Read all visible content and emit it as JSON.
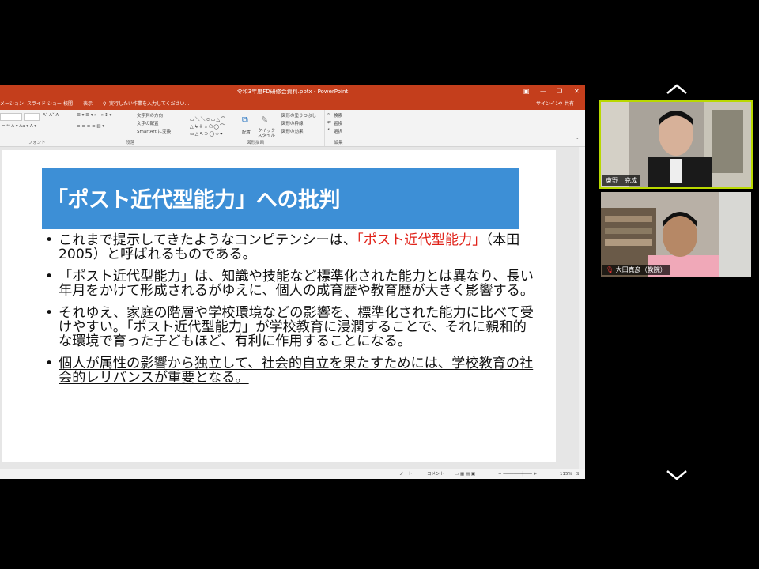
{
  "window": {
    "title": "令和3年度FD研修会資料.pptx - PowerPoint",
    "signin": "サインイン",
    "share": "共有"
  },
  "menu": {
    "tabs": [
      "メーション",
      "スライド ショー",
      "校閲",
      "表示"
    ],
    "tell_me": "実行したい作業を入力してください..."
  },
  "ribbon": {
    "group_font": "フォント",
    "group_paragraph": "段落",
    "group_drawing": "図形描画",
    "group_editing": "編集",
    "text_direction": "文字列の方向",
    "align_text": "文字の配置",
    "smartart": "SmartArt に変換",
    "arrange": "配置",
    "quick_styles": "クイック スタイル",
    "shape_fill": "図形の塗りつぶし",
    "shape_outline": "図形の枠線",
    "shape_effects": "図形の効果",
    "find": "検索",
    "replace": "置換",
    "select": "選択"
  },
  "slide": {
    "title": "「ポスト近代型能力」への批判",
    "b1_a": "これまで提示してきたようなコンピテンシーは、",
    "b1_red": "「ポスト近代型能力」",
    "b1_b": "（本田2005）と呼ばれるものである。",
    "b2": "「ポスト近代型能力」は、知識や技能など標準化された能力とは異なり、長い年月をかけて形成されるがゆえに、個人の成育歴や教育歴が大きく影響する。",
    "b3": "それゆえ、家庭の階層や学校環境などの影響を、標準化された能力に比べて受けやすい。「ポスト近代型能力」が学校教育に浸潤することで、それに親和的な環境で育った子どもほど、有利に作用することになる。",
    "b4": "個人が属性の影響から独立して、社会的自立を果たすためには、学校教育の社会的レリバンスが重要となる。"
  },
  "status": {
    "notes": "ノート",
    "comments": "コメント",
    "zoom": "115%"
  },
  "participants": [
    {
      "name": "東野　充成"
    },
    {
      "name": "大田真彦（教院）"
    }
  ]
}
